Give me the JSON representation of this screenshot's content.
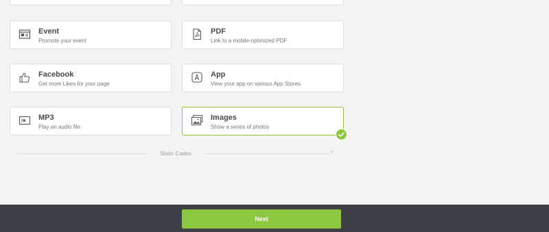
{
  "cards": [
    {
      "title": "Event",
      "description": "Promote your event",
      "icon": "event-icon"
    },
    {
      "title": "PDF",
      "description": "Link to a mobile-optimized PDF",
      "icon": "pdf-icon"
    },
    {
      "title": "Facebook",
      "description": "Get more Likes for your page",
      "icon": "thumbs-up-icon"
    },
    {
      "title": "App",
      "description": "View your app on various App Stores",
      "icon": "app-icon"
    },
    {
      "title": "MP3",
      "description": "Play an audio file",
      "icon": "play-icon"
    },
    {
      "title": "Images",
      "description": "Show a series of photos",
      "icon": "images-icon",
      "selected": true
    }
  ],
  "section_label": "Static Codes",
  "footer": {
    "next_label": "Next"
  },
  "colors": {
    "accent": "#8dc63f",
    "footer_bg": "#3c4044",
    "page_bg": "#f4f4f4"
  }
}
